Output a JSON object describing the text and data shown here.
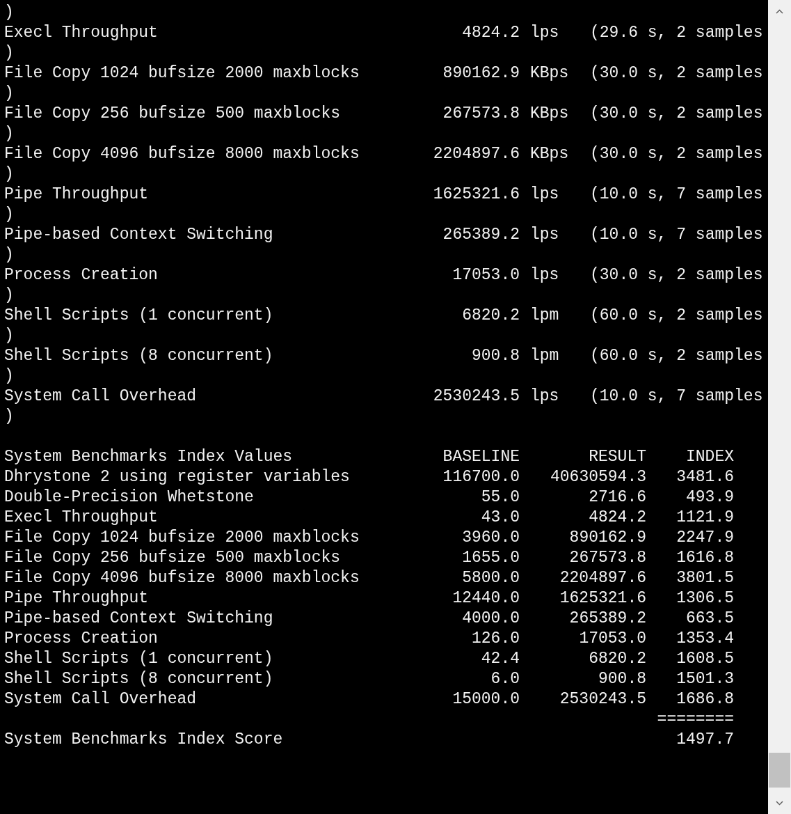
{
  "log": [
    {
      "kind": "text",
      "text": ")"
    },
    {
      "kind": "result",
      "name": "Execl Throughput",
      "value": "4824.2",
      "unit": "lps",
      "detail": "(29.6 s, 2 samples"
    },
    {
      "kind": "text",
      "text": ")"
    },
    {
      "kind": "result",
      "name": "File Copy 1024 bufsize 2000 maxblocks",
      "value": "890162.9",
      "unit": "KBps",
      "detail": "(30.0 s, 2 samples"
    },
    {
      "kind": "text",
      "text": ")"
    },
    {
      "kind": "result",
      "name": "File Copy 256 bufsize 500 maxblocks",
      "value": "267573.8",
      "unit": "KBps",
      "detail": "(30.0 s, 2 samples"
    },
    {
      "kind": "text",
      "text": ")"
    },
    {
      "kind": "result",
      "name": "File Copy 4096 bufsize 8000 maxblocks",
      "value": "2204897.6",
      "unit": "KBps",
      "detail": "(30.0 s, 2 samples"
    },
    {
      "kind": "text",
      "text": ")"
    },
    {
      "kind": "result",
      "name": "Pipe Throughput",
      "value": "1625321.6",
      "unit": "lps",
      "detail": "(10.0 s, 7 samples"
    },
    {
      "kind": "text",
      "text": ")"
    },
    {
      "kind": "result",
      "name": "Pipe-based Context Switching",
      "value": "265389.2",
      "unit": "lps",
      "detail": "(10.0 s, 7 samples"
    },
    {
      "kind": "text",
      "text": ")"
    },
    {
      "kind": "result",
      "name": "Process Creation",
      "value": "17053.0",
      "unit": "lps",
      "detail": "(30.0 s, 2 samples"
    },
    {
      "kind": "text",
      "text": ")"
    },
    {
      "kind": "result",
      "name": "Shell Scripts (1 concurrent)",
      "value": "6820.2",
      "unit": "lpm",
      "detail": "(60.0 s, 2 samples"
    },
    {
      "kind": "text",
      "text": ")"
    },
    {
      "kind": "result",
      "name": "Shell Scripts (8 concurrent)",
      "value": "900.8",
      "unit": "lpm",
      "detail": "(60.0 s, 2 samples"
    },
    {
      "kind": "text",
      "text": ")"
    },
    {
      "kind": "result",
      "name": "System Call Overhead",
      "value": "2530243.5",
      "unit": "lps",
      "detail": "(10.0 s, 7 samples"
    },
    {
      "kind": "text",
      "text": ")"
    },
    {
      "kind": "blank"
    }
  ],
  "index_table": {
    "title": "System Benchmarks Index Values",
    "columns": [
      "BASELINE",
      "RESULT",
      "INDEX"
    ],
    "rows": [
      {
        "name": "Dhrystone 2 using register variables",
        "baseline": "116700.0",
        "result": "40630594.3",
        "index": "3481.6"
      },
      {
        "name": "Double-Precision Whetstone",
        "baseline": "55.0",
        "result": "2716.6",
        "index": "493.9"
      },
      {
        "name": "Execl Throughput",
        "baseline": "43.0",
        "result": "4824.2",
        "index": "1121.9"
      },
      {
        "name": "File Copy 1024 bufsize 2000 maxblocks",
        "baseline": "3960.0",
        "result": "890162.9",
        "index": "2247.9"
      },
      {
        "name": "File Copy 256 bufsize 500 maxblocks",
        "baseline": "1655.0",
        "result": "267573.8",
        "index": "1616.8"
      },
      {
        "name": "File Copy 4096 bufsize 8000 maxblocks",
        "baseline": "5800.0",
        "result": "2204897.6",
        "index": "3801.5"
      },
      {
        "name": "Pipe Throughput",
        "baseline": "12440.0",
        "result": "1625321.6",
        "index": "1306.5"
      },
      {
        "name": "Pipe-based Context Switching",
        "baseline": "4000.0",
        "result": "265389.2",
        "index": "663.5"
      },
      {
        "name": "Process Creation",
        "baseline": "126.0",
        "result": "17053.0",
        "index": "1353.4"
      },
      {
        "name": "Shell Scripts (1 concurrent)",
        "baseline": "42.4",
        "result": "6820.2",
        "index": "1608.5"
      },
      {
        "name": "Shell Scripts (8 concurrent)",
        "baseline": "6.0",
        "result": "900.8",
        "index": "1501.3"
      },
      {
        "name": "System Call Overhead",
        "baseline": "15000.0",
        "result": "2530243.5",
        "index": "1686.8"
      }
    ],
    "rule": "========",
    "score_label": "System Benchmarks Index Score",
    "score": "1497.7"
  }
}
